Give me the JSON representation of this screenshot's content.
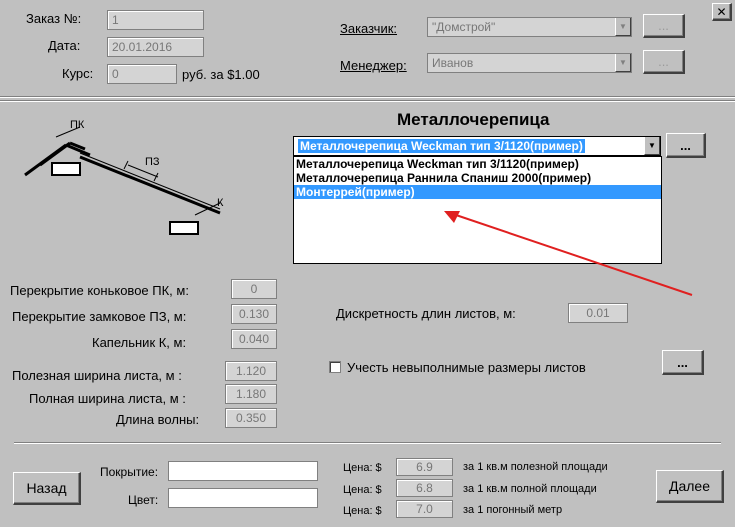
{
  "window": {
    "close_label": "✕"
  },
  "header": {
    "order_label": "Заказ №:",
    "order_value": "1",
    "date_label": "Дата:",
    "date_value": "20.01.2016",
    "rate_label": "Курс:",
    "rate_value": "0",
    "rate_suffix": "руб. за $1.00",
    "customer_label": "Заказчик:",
    "customer_value": "\"Домстрой\"",
    "manager_label": "Менеджер:",
    "manager_value": "Иванов",
    "browse_label": "...",
    "browse_label2": "..."
  },
  "main": {
    "title": "Металлочерепица",
    "diagram": {
      "pk": "ПК",
      "pz": "ПЗ",
      "k": "К"
    },
    "combo_value": "Металлочерепица Weckman тип 3/1120(пример)",
    "combo_button": "...",
    "options": [
      "Металлочерепица Weckman тип 3/1120(пример)",
      "Металлочерепица Раннила Спаниш 2000(пример)",
      "Монтеррей(пример)"
    ],
    "selected_index": 2,
    "params": [
      {
        "label": "Перекрытие коньковое ПК, м:",
        "value": "0"
      },
      {
        "label": "Перекрытие замковое ПЗ, м:",
        "value": "0.130"
      },
      {
        "label": "Капельник К, м:",
        "value": "0.040"
      },
      {
        "label": "Полезная ширина листа, м :",
        "value": "1.120"
      },
      {
        "label": "Полная ширина листа, м :",
        "value": "1.180"
      },
      {
        "label": "Длина волны:",
        "value": "0.350"
      }
    ],
    "discreteness_label": "Дискретность длин листов, м:",
    "discreteness_value": "0.01",
    "checkbox_label": "Учесть невыполнимые размеры листов",
    "checkbox_button": "..."
  },
  "footer": {
    "back_label": "Назад",
    "next_label": "Далее",
    "coating_label": "Покрытие:",
    "coating_value": "",
    "color_label": "Цвет:",
    "color_value": "",
    "prices": [
      {
        "label": "Цена: $",
        "value": "6.9",
        "desc": "за 1 кв.м полезной площади"
      },
      {
        "label": "Цена: $",
        "value": "6.8",
        "desc": "за 1 кв.м полной площади"
      },
      {
        "label": "Цена: $",
        "value": "7.0",
        "desc": "за 1 погонный метр"
      }
    ]
  }
}
